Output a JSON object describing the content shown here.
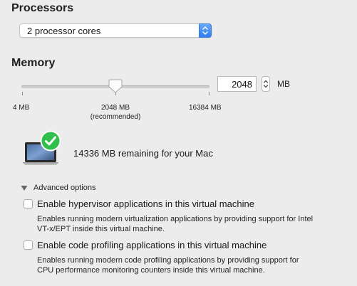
{
  "processors": {
    "title": "Processors",
    "selected": "2 processor cores"
  },
  "memory": {
    "title": "Memory",
    "value": "2048",
    "unit": "MB",
    "slider": {
      "min_label": "4 MB",
      "mid_label": "2048 MB",
      "mid_sublabel": "(recommended)",
      "max_label": "16384 MB"
    },
    "remaining_text": "14336 MB remaining for your Mac"
  },
  "advanced": {
    "label": "Advanced options",
    "options": [
      {
        "label": "Enable hypervisor applications in this virtual machine",
        "desc_line1": "Enables running modern virtualization applications by providing support for Intel",
        "desc_line2": "VT-x/EPT inside this virtual machine."
      },
      {
        "label": "Enable code profiling applications in this virtual machine",
        "desc_line1": "Enables running modern code profiling applications by providing support for",
        "desc_line2": "CPU performance monitoring counters inside this virtual machine."
      }
    ]
  },
  "colors": {
    "accent": "#2f7ff2",
    "success": "#2fbf4a",
    "background": "#ececec"
  },
  "icons": {
    "laptop": "macbook-icon",
    "check": "checkmark-badge-icon"
  }
}
